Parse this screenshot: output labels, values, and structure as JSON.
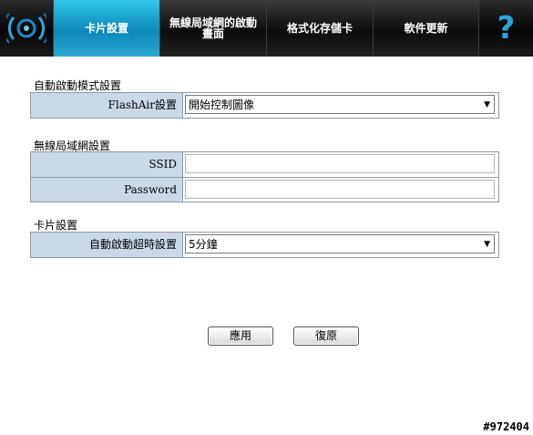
{
  "tabs": [
    {
      "label": "卡片設置",
      "active": true
    },
    {
      "label": "無線局域網的啟動畫面",
      "active": false
    },
    {
      "label": "格式化存儲卡",
      "active": false
    },
    {
      "label": "軟件更新",
      "active": false
    }
  ],
  "help_label": "?",
  "sections": {
    "autostart": {
      "title": "自動啟動模式設置",
      "flashair_label": "FlashAir設置",
      "flashair_value": "開始控制圖像"
    },
    "wlan": {
      "title": "無線局域網設置",
      "ssid_label": "SSID",
      "ssid_value": "",
      "password_label": "Password",
      "password_value": ""
    },
    "card": {
      "title": "卡片設置",
      "timeout_label": "自動啟動超時設置",
      "timeout_value": "5分鐘"
    }
  },
  "buttons": {
    "apply": "應用",
    "restore": "復原"
  },
  "watermark": "#972404",
  "colors": {
    "active_tab": "#0b88b8",
    "label_bg": "#c9d9e8",
    "topbar": "#050505"
  }
}
